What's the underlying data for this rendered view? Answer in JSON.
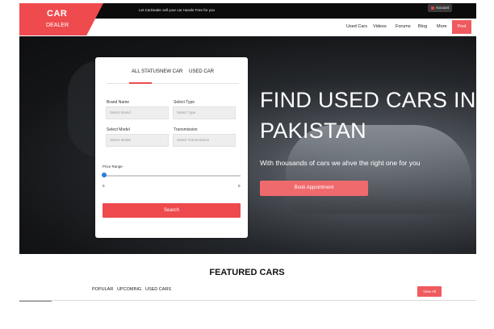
{
  "topbar": {
    "message": "Let CarDealer sell your car Hassle Free for you",
    "account_label": "Account"
  },
  "logo": {
    "line1": "CAR",
    "line2": "DEALER"
  },
  "nav": {
    "items": [
      "Used Cars",
      "Videos",
      "Forums",
      "Blog",
      "More"
    ],
    "post_label": "Post"
  },
  "hero": {
    "headline_line1": "FIND USED CARS IN",
    "headline_line2": "PAKISTAN",
    "subtitle": "With thousands of cars we ahve the right one for you",
    "book_label": "Book Appointment"
  },
  "search": {
    "tabs": [
      "ALL STATUS",
      "NEW CAR",
      "USED CAR"
    ],
    "active_tab": "ALL STATUS",
    "fields": [
      {
        "label": "Brand Name",
        "placeholder": "Select Brand"
      },
      {
        "label": "Select Type",
        "placeholder": "Select Type"
      },
      {
        "label": "Select Model",
        "placeholder": "Select Model"
      },
      {
        "label": "Transmission",
        "placeholder": "Select Transmission"
      }
    ],
    "price_label": "Price Range",
    "price_min": "0",
    "price_max": "0",
    "price_fraction": 0,
    "search_label": "Search"
  },
  "featured": {
    "title": "FEATURED CARS",
    "tabs": [
      "POPULAR",
      "UPCOMING",
      "USED CARS"
    ],
    "view_all": "View All"
  },
  "colors": {
    "accent": "#ef4b4f",
    "topbar": "#0b0b0b",
    "slider": "#2c7bd9"
  }
}
